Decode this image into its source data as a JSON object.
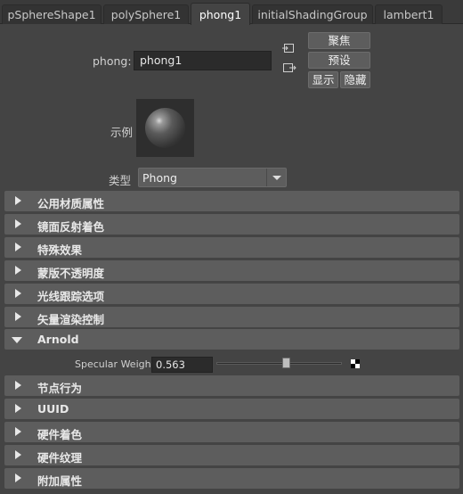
{
  "tabs": [
    {
      "label": "pSphereShape1",
      "active": false
    },
    {
      "label": "polySphere1",
      "active": false
    },
    {
      "label": "phong1",
      "active": true
    },
    {
      "label": "initialShadingGroup",
      "active": false
    },
    {
      "label": "lambert1",
      "active": false
    }
  ],
  "header": {
    "name_label": "phong:",
    "name_value": "phong1",
    "focus_label": "聚焦",
    "presets_label": "预设",
    "show_label": "显示",
    "hide_label": "隐藏",
    "input_icon": "input-connection-icon",
    "output_icon": "output-connection-icon"
  },
  "swatch": {
    "label": "示例",
    "icon": "material-sphere-preview"
  },
  "type": {
    "label": "类型",
    "value": "Phong"
  },
  "sections_top": [
    {
      "label": "公用材质属性",
      "expanded": false
    },
    {
      "label": "镜面反射着色",
      "expanded": false
    },
    {
      "label": "特殊效果",
      "expanded": false
    },
    {
      "label": "蒙版不透明度",
      "expanded": false
    },
    {
      "label": "光线跟踪选项",
      "expanded": false
    },
    {
      "label": "矢量渲染控制",
      "expanded": false
    }
  ],
  "arnold": {
    "label": "Arnold",
    "expanded": true,
    "specular_weight_label": "Specular Weight",
    "specular_weight_value": "0.563",
    "specular_weight_fraction": 0.563,
    "map_button_icon": "checker-map-icon"
  },
  "sections_bottom": [
    {
      "label": "节点行为",
      "expanded": false
    },
    {
      "label": "UUID",
      "expanded": false
    },
    {
      "label": "硬件着色",
      "expanded": false
    },
    {
      "label": "硬件纹理",
      "expanded": false
    },
    {
      "label": "附加属性",
      "expanded": false
    }
  ]
}
